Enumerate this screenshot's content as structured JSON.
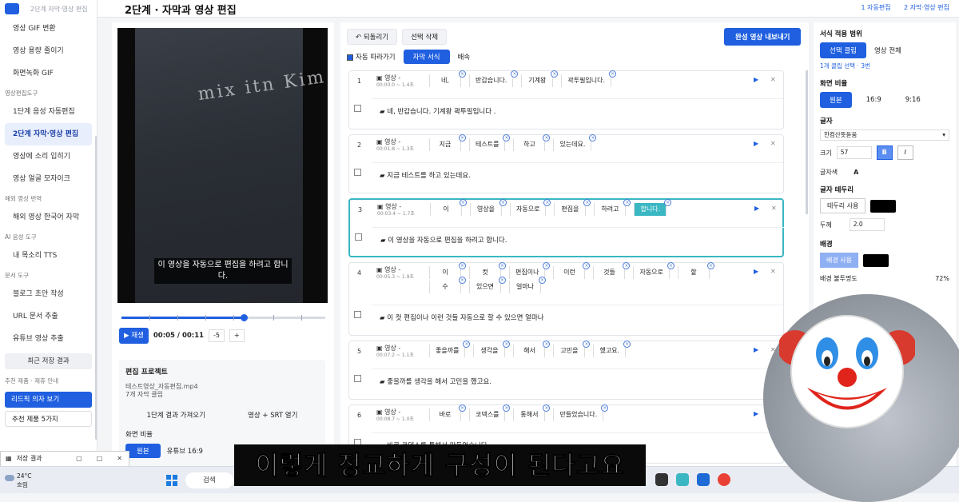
{
  "sidebar": {
    "top_label": "2단계 자막·영상 편집",
    "items_a": [
      "영상 GIF 변환",
      "영상 용량 줄이기",
      "화면녹화 GIF"
    ],
    "section_edit": "영상편집도구",
    "items_b": [
      "1단계 음성 자동편집",
      "2단계 자막·영상 편집",
      "영상에 소리 입히기",
      "영상 얼굴 모자이크"
    ],
    "section_foreign": "해외 영상 번역",
    "items_c": [
      "해외 영상 한국어 자막"
    ],
    "section_ai": "AI 음성 도구",
    "items_d": [
      "내 목소리 TTS"
    ],
    "section_doc": "문서 도구",
    "items_e": [
      "블로그 초안 작성",
      "URL 문서 추출",
      "유튜브 영상 추출"
    ],
    "recent_btn": "최근 저장 결과",
    "section_reco": "추천 제품 · 제휴 안내",
    "reco_btn": "리드픽 의자 보기",
    "reco_btn2": "추천 제품 5가지"
  },
  "header": {
    "title": "2단계 · 자막과 영상 편집",
    "crumb1": "1 자동편집",
    "crumb2": "2 자막·영상 편집"
  },
  "video": {
    "shirt_text": "mix itn Kim",
    "caption": "이 영상을 자동으로 편집을 하려고 합니다.",
    "progress": 0.6,
    "play_label": "▶ 재생",
    "time": "00:05 / 00:11",
    "back": "-5",
    "fwd": "+"
  },
  "project": {
    "title": "편집 프로젝트",
    "file": "테스트영상_자동편집.mp4",
    "clips": "7개 자막 클립",
    "load_btn": "1단계 결과 가져오기",
    "open_btn": "영상 + SRT 열기",
    "ratio_label": "화면 비율",
    "ratio_on": "원본",
    "ratio_off": "유튜브 16:9"
  },
  "center": {
    "undo": "↶ 되돌리기",
    "del": "선택 삭제",
    "export": "완성 영상 내보내기",
    "follow": "자동 따라가기",
    "tab_on": "자막 서식",
    "tab_off": "배속"
  },
  "rows": [
    {
      "num": "1",
      "label": "영상 -",
      "time": "00:00.0 ~ 1.4초",
      "words": [
        "네,",
        "반갑습니다.",
        "기계왕",
        "곽투필입니다."
      ],
      "text": "네, 반갑습니다. 기계왕 곽투필입니다 ."
    },
    {
      "num": "2",
      "label": "영상 -",
      "time": "00:01.8 ~ 1.3초",
      "words": [
        "지금",
        "테스트를",
        "하고",
        "있는데요."
      ],
      "text": "지금 테스트를 하고 있는데요."
    },
    {
      "num": "3",
      "label": "영상 -",
      "time": "00:03.4 ~ 1.7초",
      "words": [
        "이",
        "영상을",
        "자동으로",
        "편집을",
        "하려고",
        "합니다."
      ],
      "text": "이 영상을 자동으로 편집을 하려고 합니다."
    },
    {
      "num": "4",
      "label": "영상 -",
      "time": "00:05.3 ~ 1.9초",
      "words": [
        "이",
        "컷",
        "편집이나",
        "이런",
        "것들",
        "자동으로",
        "할",
        "수",
        "있으면",
        "얼마나"
      ],
      "text": "이 컷 편집이나 이런 것들 자동으로 할 수 있으면 얼마나"
    },
    {
      "num": "5",
      "label": "영상 -",
      "time": "00:07.2 ~ 1.1초",
      "words": [
        "좋을까를",
        "생각을",
        "해서",
        "고민을",
        "했고요."
      ],
      "text": "좋을까를 생각을 해서 고민을 했고요."
    },
    {
      "num": "6",
      "label": "영상 -",
      "time": "00:08.7 ~ 1.0초",
      "words": [
        "바로",
        "코덱스를",
        "통해서",
        "만들었습니다."
      ],
      "text": "바로 코덱스를 통해서 만들었습니다."
    }
  ],
  "right": {
    "scope_h": "서식 적용 범위",
    "scope_on": "선택 클립",
    "scope_off": "영상 전체",
    "scope_note": "1개 클립 선택 · 3번",
    "ratio_h": "화면 비율",
    "ratio_on": "원본",
    "ratio_b": "16:9",
    "ratio_c": "9:16",
    "font_h": "글자",
    "font": "한컴산뜻돋움",
    "size_label": "크기",
    "size": "57",
    "bold": "B",
    "italic": "I",
    "color_label": "글자색",
    "color_val": "A",
    "border_h": "글자 테두리",
    "border_btn": "테두리 사용",
    "thick_label": "두께",
    "thick": "2.0",
    "bg_h": "배경",
    "bg_btn": "배경 사용",
    "opacity_label": "배경 불투명도",
    "opacity": "72%"
  },
  "overlay": {
    "subtitle": "이렇게 정교하게 구성이 된다고요"
  },
  "taskbar": {
    "temp": "24°C",
    "weather": "흐림",
    "search": "검색",
    "window": "저장 결과"
  }
}
